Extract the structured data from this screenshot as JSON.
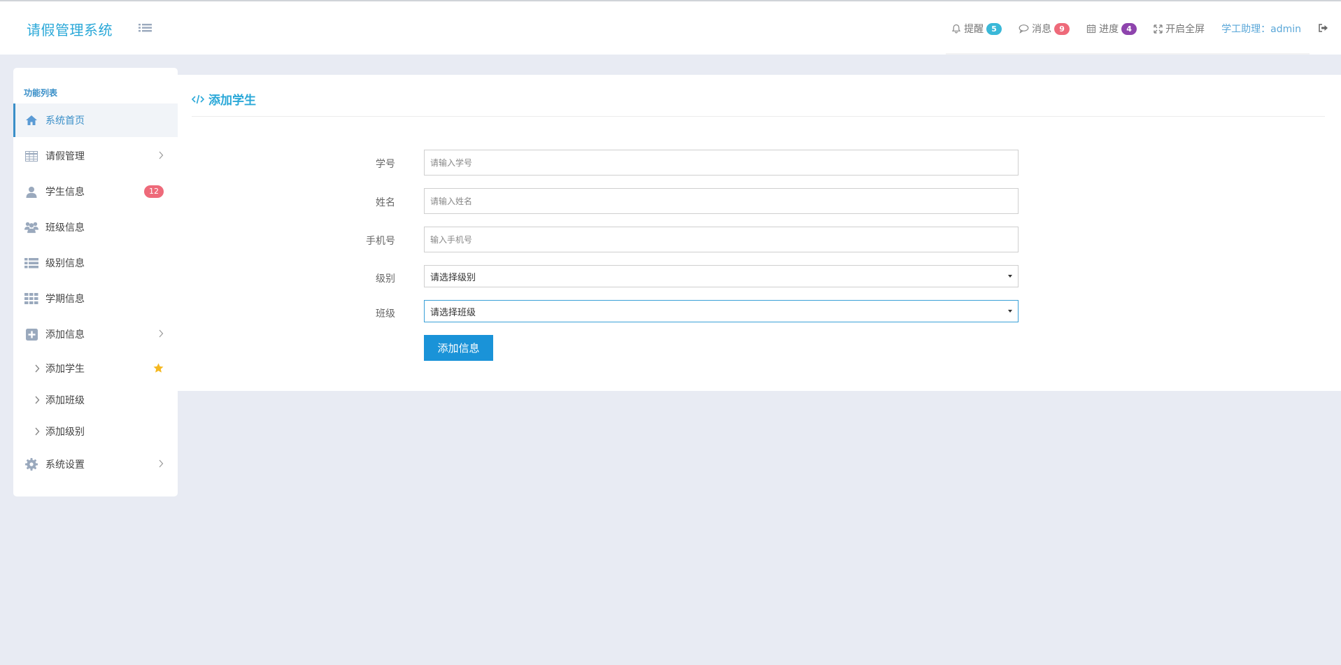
{
  "header": {
    "brand": "请假管理系统",
    "reminder_label": "提醒",
    "reminder_count": "5",
    "message_label": "消息",
    "message_count": "9",
    "progress_label": "进度",
    "progress_count": "4",
    "fullscreen_label": "开启全屏",
    "user_label": "学工助理：admin"
  },
  "colors": {
    "brand": "#2aa8d8",
    "reminder_badge": "#3ab8d8",
    "message_badge": "#ee6a7a",
    "progress_badge": "#8e44ad",
    "primary_button": "#1a93d8",
    "star": "#f5b820"
  },
  "sidebar": {
    "title": "功能列表",
    "items": [
      {
        "label": "系统首页",
        "icon": "home-icon",
        "active": true
      },
      {
        "label": "请假管理",
        "icon": "table-icon"
      },
      {
        "label": "学生信息",
        "icon": "user-icon",
        "badge": "12"
      },
      {
        "label": "班级信息",
        "icon": "users-icon"
      },
      {
        "label": "级别信息",
        "icon": "list-icon"
      },
      {
        "label": "学期信息",
        "icon": "grid-icon"
      },
      {
        "label": "添加信息",
        "icon": "plus-square-icon"
      },
      {
        "label": "系统设置",
        "icon": "gear-icon"
      }
    ],
    "sub_items": [
      {
        "label": "添加学生",
        "starred": true
      },
      {
        "label": "添加班级"
      },
      {
        "label": "添加级别"
      }
    ]
  },
  "panel": {
    "title": "添加学生",
    "fields": {
      "student_id": {
        "label": "学号",
        "placeholder": "请输入学号"
      },
      "name": {
        "label": "姓名",
        "placeholder": "请输入姓名"
      },
      "phone": {
        "label": "手机号",
        "placeholder": "输入手机号"
      },
      "level": {
        "label": "级别",
        "value": "请选择级别"
      },
      "class": {
        "label": "班级",
        "value": "请选择班级"
      }
    },
    "submit_label": "添加信息"
  }
}
